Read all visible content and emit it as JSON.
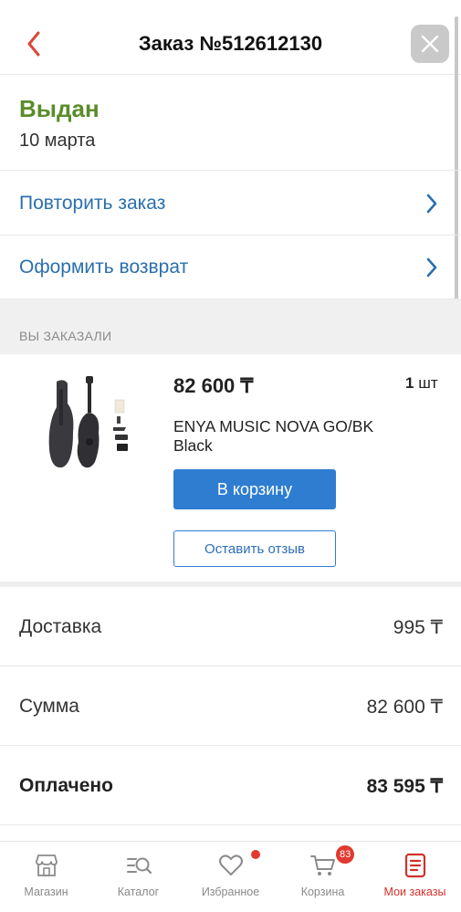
{
  "header": {
    "title": "Заказ №512612130",
    "back_icon": "chevron-left-icon",
    "close_icon": "close-icon"
  },
  "status": {
    "text": "Выдан",
    "date": "10 марта",
    "color": "#5b8c2a"
  },
  "actions": [
    {
      "label": "Повторить заказ",
      "icon": "chevron-right-icon"
    },
    {
      "label": "Оформить возврат",
      "icon": "chevron-right-icon"
    }
  ],
  "section": {
    "title": "ВЫ ЗАКАЗАЛИ"
  },
  "product": {
    "price": "82 600 ₸",
    "qty_number": "1",
    "qty_unit": "шт",
    "name": "ENYA MUSIC NOVA GO/BK Black",
    "add_to_cart_label": "В корзину",
    "review_label": "Оставить отзыв",
    "image_icon": "guitar-product-image"
  },
  "summary": [
    {
      "label": "Доставка",
      "value": "995 ₸"
    },
    {
      "label": "Сумма",
      "value": "82 600 ₸"
    },
    {
      "label": "Оплачено",
      "value": "83 595 ₸"
    }
  ],
  "tabs": [
    {
      "label": "Магазин",
      "icon": "store-icon"
    },
    {
      "label": "Каталог",
      "icon": "catalog-search-icon"
    },
    {
      "label": "Избранное",
      "icon": "heart-icon"
    },
    {
      "label": "Корзина",
      "icon": "cart-icon",
      "badge": "83"
    },
    {
      "label": "Мои заказы",
      "icon": "orders-icon"
    }
  ],
  "colors": {
    "accent_blue": "#2e7dd1",
    "link_blue": "#2a6fad",
    "active_tab": "#d1302a",
    "badge_red": "#e2382f"
  }
}
